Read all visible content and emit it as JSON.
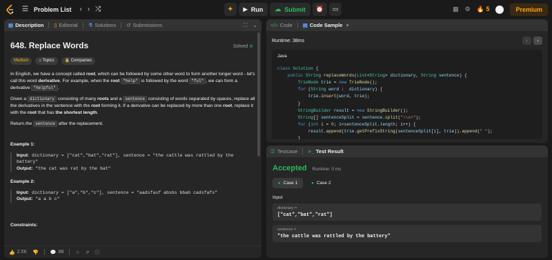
{
  "topbar": {
    "problem_list": "Problem List",
    "run": "Run",
    "submit": "Submit",
    "streak": "5",
    "premium": "Premium"
  },
  "left": {
    "tabs": [
      "Description",
      "Editorial",
      "Solutions",
      "Submissions"
    ],
    "title": "648. Replace Words",
    "solved": "Solved",
    "difficulty": "Medium",
    "topics": "Topics",
    "companies": "Companies",
    "p1": {
      "a": "In English, we have a concept called ",
      "b": "root",
      "c": ", which can be followed by some other word to form another longer word - let's call this word ",
      "d": "derivative",
      "e": ". For example, when the ",
      "f": "root",
      "g": "\"help\"",
      "h": " is followed by the word ",
      "i": "\"ful\"",
      "j": ", we can form a derivative ",
      "k": "\"helpful\"",
      "l": "."
    },
    "p2": {
      "a": "Given a ",
      "b": "dictionary",
      "c": " consisting of many ",
      "d": "roots",
      "e": " and a ",
      "f": "sentence",
      "g": " consisting of words separated by spaces, replace all the derivatives in the sentence with the ",
      "h": "root",
      "i": " forming it. If a derivative can be replaced by more than one ",
      "j": "root",
      "k": ", replace it with the ",
      "l": "root",
      "m": " that has ",
      "n": "the shortest length",
      "o": "."
    },
    "p3": {
      "a": "Return ",
      "b": "the ",
      "c": "sentence",
      "d": " after the replacement."
    },
    "example1": {
      "heading": "Example 1:",
      "input_label": "Input:",
      "input": " dictionary = [\"cat\",\"bat\",\"rat\"], sentence = \"the cattle was rattled by the battery\"",
      "output_label": "Output:",
      "output": " \"the cat was rat by the bat\""
    },
    "example2": {
      "heading": "Example 2:",
      "input_label": "Input:",
      "input": " dictionary = [\"a\",\"b\",\"c\"], sentence = \"aadsfasf absbs bbab cadsfafs\"",
      "output_label": "Output:",
      "output": " \"a a b c\""
    },
    "constraints": "Constraints:",
    "footer": {
      "likes": "2.5K",
      "comments": "88"
    }
  },
  "code": {
    "tabs": [
      "Code",
      "Code Sample"
    ],
    "runtime": "Runtime: 38ms",
    "lang": "Java"
  },
  "test": {
    "tabs": [
      "Testcase",
      "Test Result"
    ],
    "status": "Accepted",
    "runtime": "Runtime: 0 ms",
    "cases": [
      "Case 1",
      "Case 2"
    ],
    "input_label": "Input",
    "fields": [
      {
        "name": "dictionary =",
        "value": "[\"cat\",\"bat\",\"rat\"]"
      },
      {
        "name": "sentence =",
        "value": "\"the cattle was rattled by the battery\""
      }
    ]
  },
  "colors": {
    "accent": "#ffa116",
    "success": "#2cbb5d",
    "medium": "#ffb800"
  },
  "icons": [
    "leetcode-logo",
    "list-icon",
    "chevron-left-icon",
    "chevron-right-icon",
    "shuffle-icon",
    "play-icon",
    "cloud-upload-icon",
    "alarm-icon",
    "note-icon",
    "grid-icon",
    "gear-icon",
    "fire-icon"
  ]
}
